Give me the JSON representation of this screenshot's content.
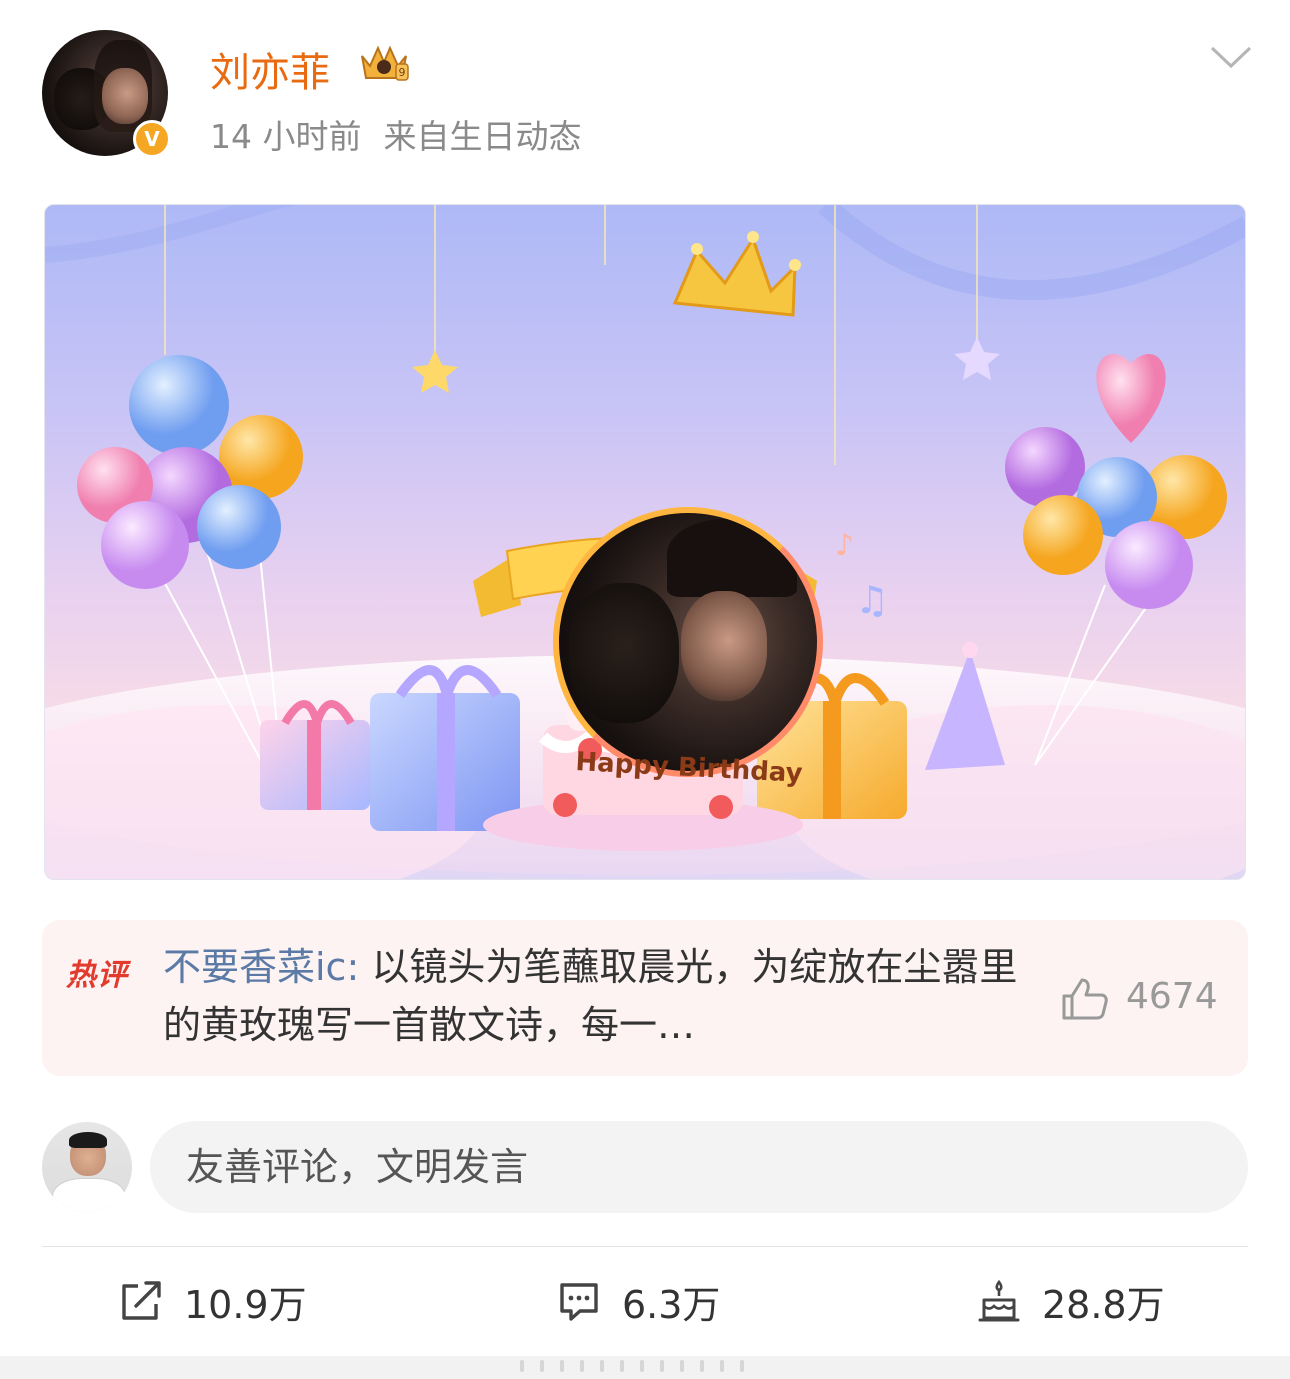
{
  "post": {
    "author": "刘亦菲",
    "verified_badge": "V",
    "time": "14 小时前",
    "source": "来自生日动态",
    "card_text": "Happy Birthday"
  },
  "hot_comment": {
    "label": "热评",
    "author": "不要香菜ic:",
    "text": "以镜头为笔蘸取晨光，为绽放在尘嚣里的黄玫瑰写一首散文诗，每一…",
    "like_count": "4674"
  },
  "comment_box": {
    "placeholder": "友善评论，文明发言"
  },
  "actions": {
    "repost_count": "10.9万",
    "comment_count": "6.3万",
    "like_count": "28.8万"
  },
  "colors": {
    "username": "#e86b12",
    "hot_label": "#e23b2d",
    "hot_author": "#5b7aa6",
    "hot_bg": "#fdf3f3"
  },
  "icons": [
    "crown-badge-icon",
    "chevron-down-icon",
    "thumbs-up-icon",
    "repost-icon",
    "comment-icon",
    "cake-like-icon"
  ]
}
